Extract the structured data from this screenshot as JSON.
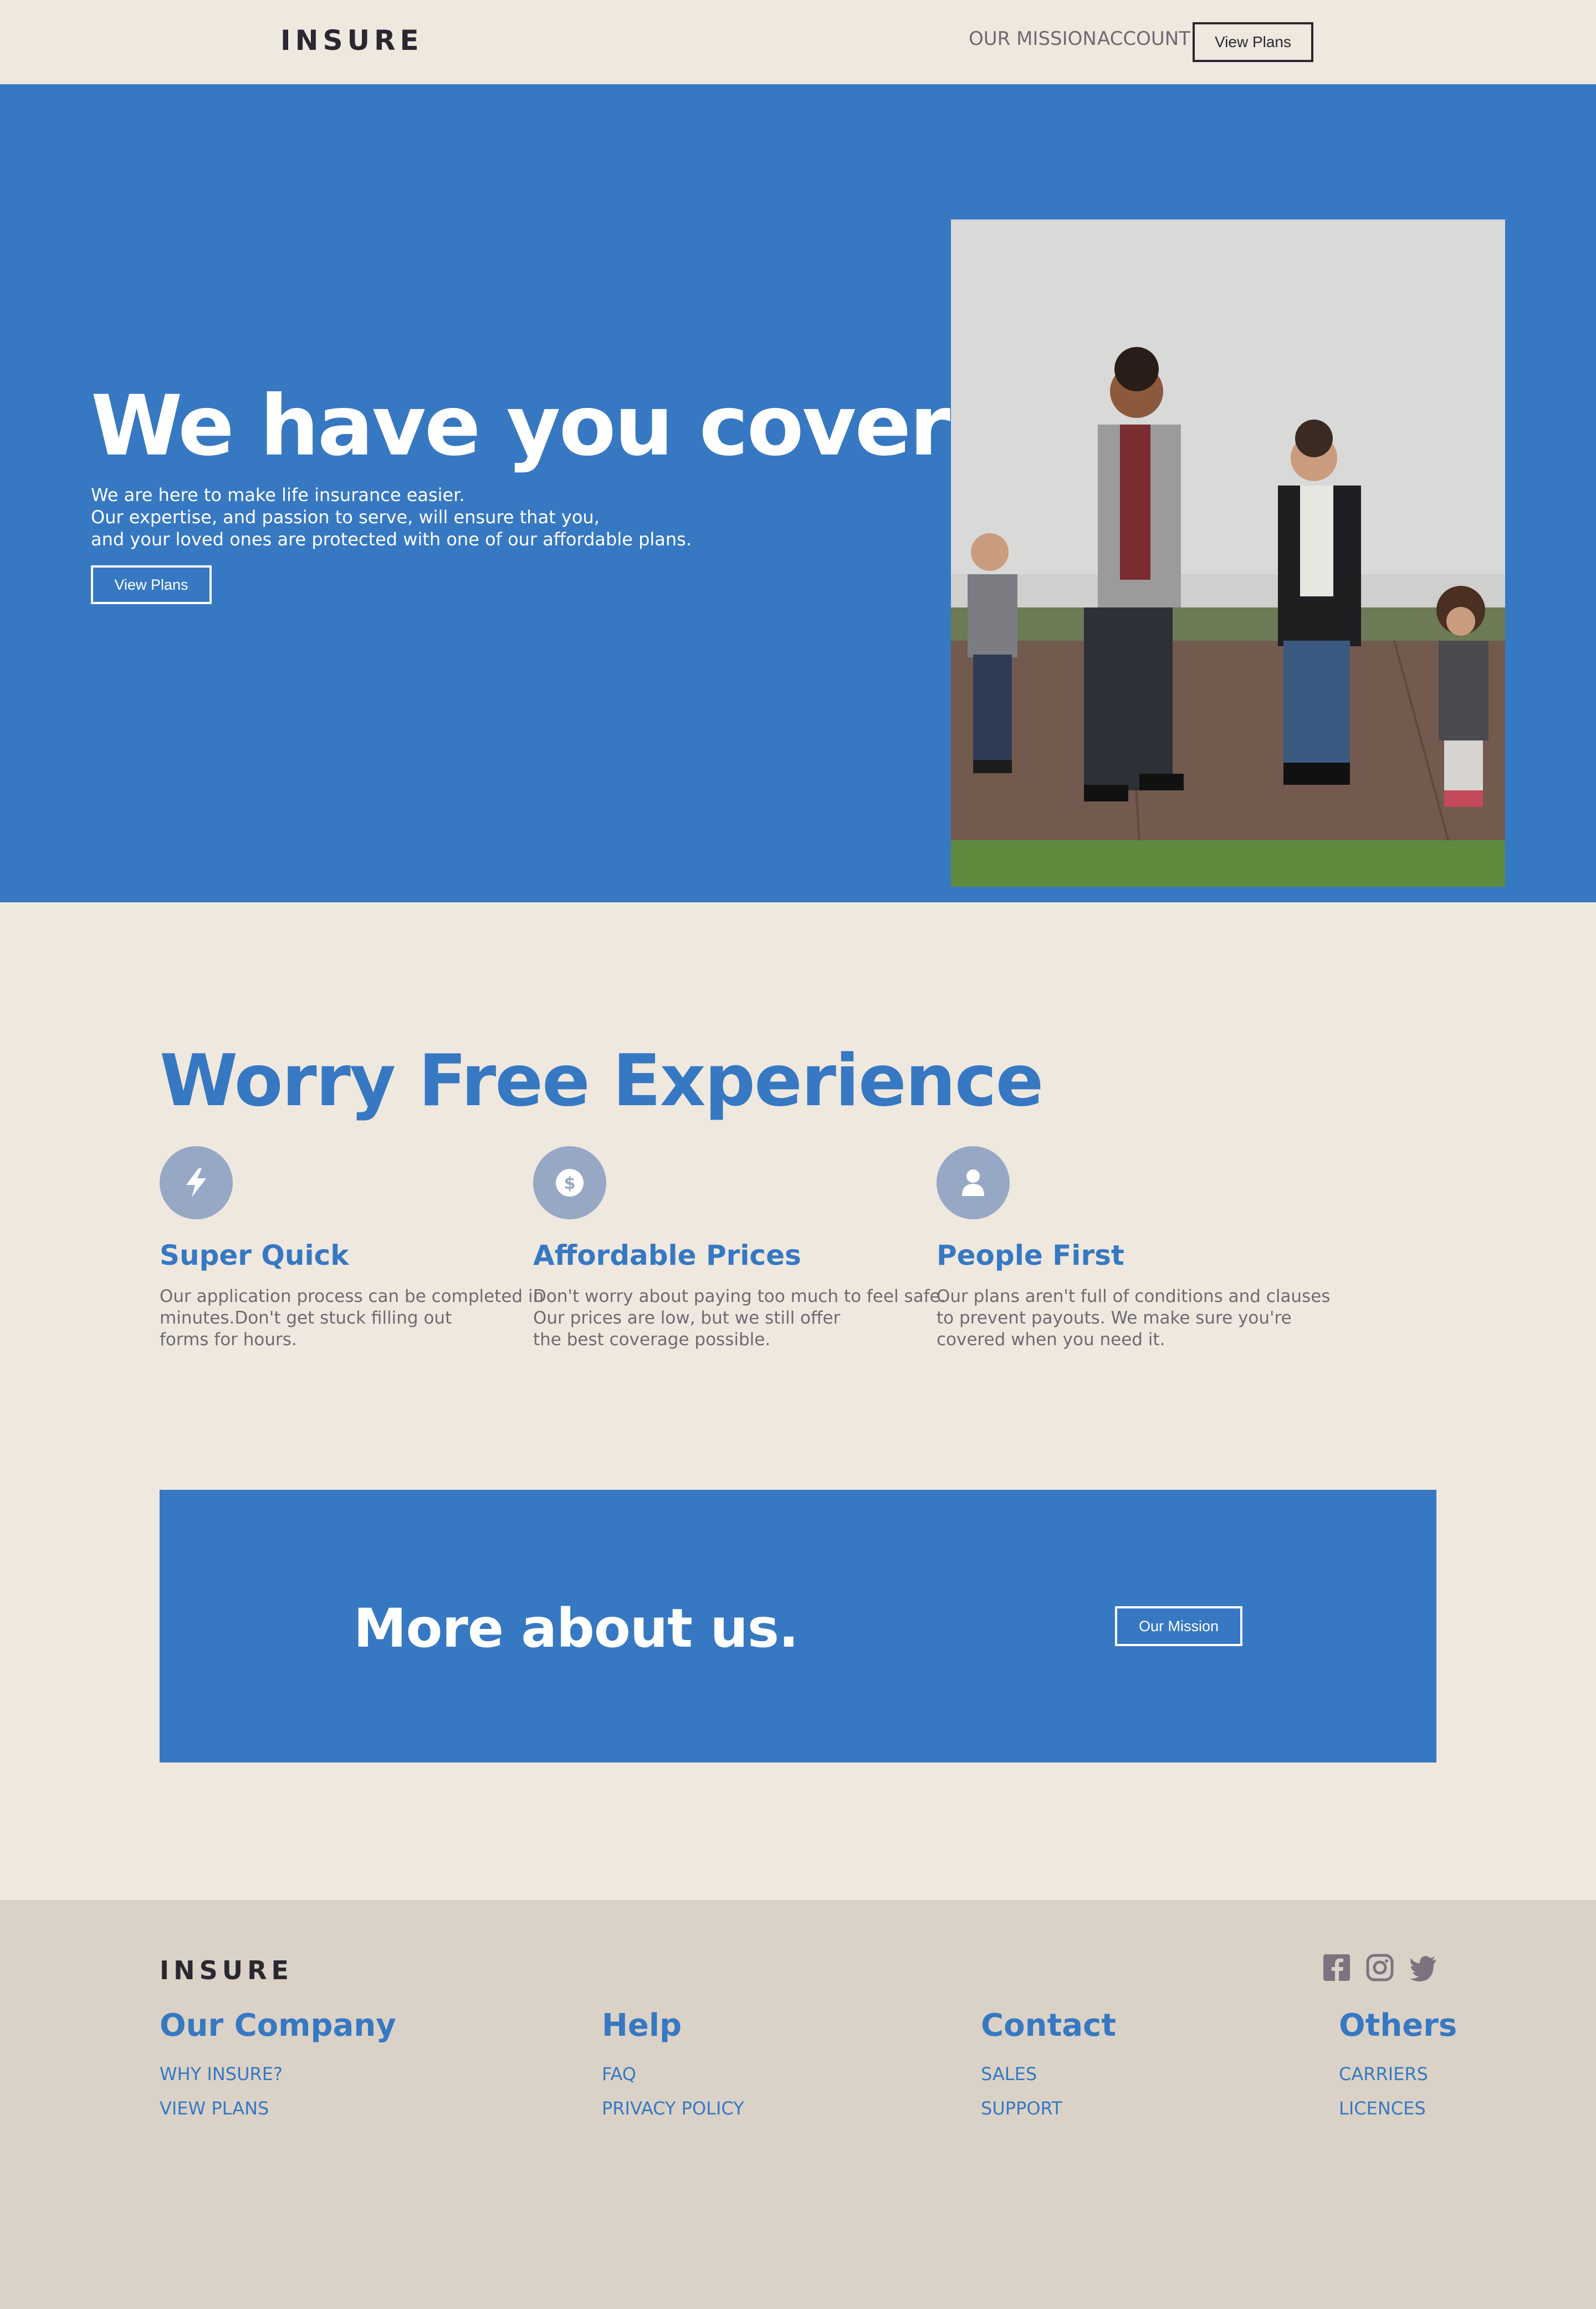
{
  "nav": {
    "logo": "INSURE",
    "links": [
      "OUR MISSION",
      "ACCOUNT"
    ],
    "cta_label": "View Plans"
  },
  "hero": {
    "title": "We have you covered.",
    "lines": [
      "We are here to make life insurance easier.",
      "Our expertise, and passion to serve, will ensure that you,",
      "and your loved ones are protected with one of our affordable plans."
    ],
    "button_label": "View Plans"
  },
  "features": {
    "title": "Worry Free Experience",
    "items": [
      {
        "icon": "lightning-bolt-icon",
        "title": "Super Quick",
        "lines": [
          "Our application process can be completed in",
          "minutes.Don't get stuck filling out",
          "forms for hours."
        ]
      },
      {
        "icon": "dollar-icon",
        "title": "Affordable Prices",
        "lines": [
          "Don't worry about paying too much to feel safe.",
          "Our prices are low, but we still offer",
          "the best coverage possible."
        ]
      },
      {
        "icon": "user-icon",
        "title": "People First",
        "lines": [
          "Our plans aren't full of conditions and clauses",
          "to prevent payouts. We make sure you're",
          "covered when you need it."
        ]
      }
    ]
  },
  "cta": {
    "title": "More about us.",
    "button_label": "Our Mission"
  },
  "footer": {
    "logo": "INSURE",
    "social": [
      "facebook-icon",
      "instagram-icon",
      "twitter-icon"
    ],
    "columns": [
      {
        "heading": "Our Company",
        "links": [
          "WHY INSURE?",
          "VIEW PLANS"
        ]
      },
      {
        "heading": "Help",
        "links": [
          "FAQ",
          "PRIVACY POLICY"
        ]
      },
      {
        "heading": "Contact",
        "links": [
          "SALES",
          "SUPPORT"
        ]
      },
      {
        "heading": "Others",
        "links": [
          "CARRIERS",
          "LICENCES"
        ]
      }
    ]
  },
  "colors": {
    "brand_blue": "#3778c2",
    "background": "#efe8df",
    "footer_background": "#dad2c7",
    "icon_circle": "#97a8c5",
    "text_gray": "#6f6a72"
  }
}
